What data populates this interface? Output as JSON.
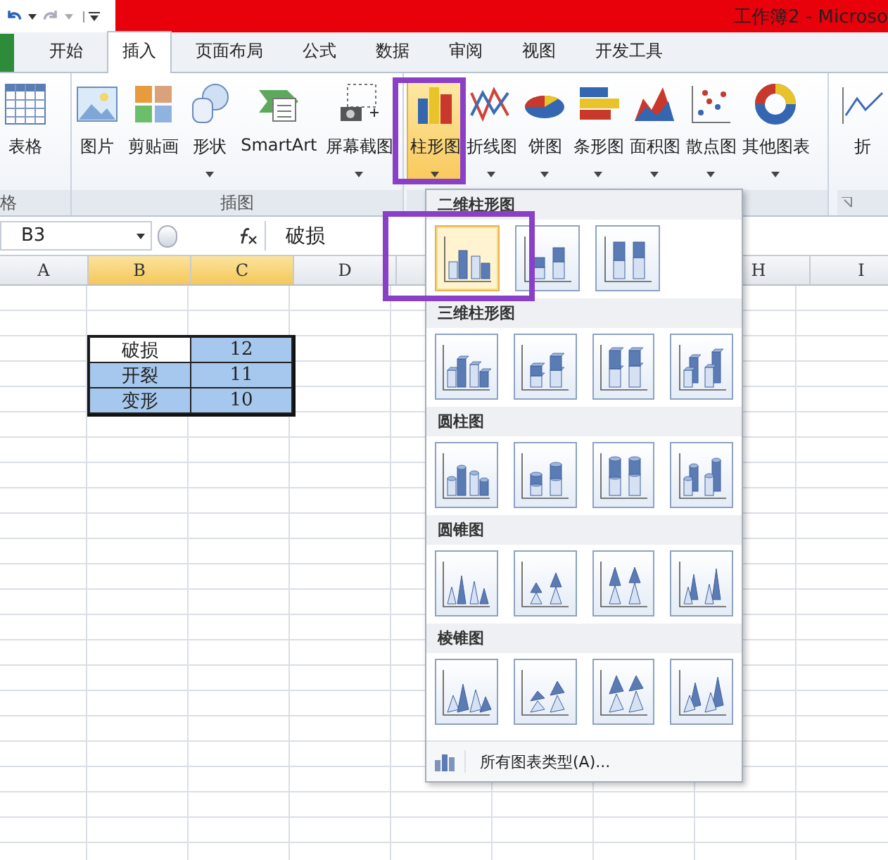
{
  "title_bar": {
    "title": "工作簿2 - Microso"
  },
  "tabs": [
    {
      "label": "开始",
      "selected": false
    },
    {
      "label": "插入",
      "selected": true
    },
    {
      "label": "页面布局",
      "selected": false
    },
    {
      "label": "公式",
      "selected": false
    },
    {
      "label": "数据",
      "selected": false
    },
    {
      "label": "审阅",
      "selected": false
    },
    {
      "label": "视图",
      "selected": false
    },
    {
      "label": "开发工具",
      "selected": false
    }
  ],
  "ribbon": {
    "groups": [
      {
        "label": "格",
        "buttons": [
          {
            "label": "表格",
            "kind": "table",
            "menu": false,
            "selected": false
          }
        ]
      },
      {
        "label": "插图",
        "buttons": [
          {
            "label": "图片",
            "kind": "picture",
            "menu": false,
            "selected": false
          },
          {
            "label": "剪贴画",
            "kind": "clipart",
            "menu": false,
            "selected": false
          },
          {
            "label": "形状",
            "kind": "shapes",
            "menu": true,
            "selected": false
          },
          {
            "label": "SmartArt",
            "kind": "smartart",
            "menu": false,
            "selected": false
          },
          {
            "label": "屏幕截图",
            "kind": "screenshot",
            "menu": true,
            "selected": false
          }
        ]
      },
      {
        "buttons": [
          {
            "label": "柱形图",
            "kind": "column",
            "menu": true,
            "selected": true
          },
          {
            "label": "折线图",
            "kind": "line",
            "menu": true,
            "selected": false
          },
          {
            "label": "饼图",
            "kind": "pie",
            "menu": true,
            "selected": false
          },
          {
            "label": "条形图",
            "kind": "bar",
            "menu": true,
            "selected": false
          },
          {
            "label": "面积图",
            "kind": "area",
            "menu": true,
            "selected": false
          },
          {
            "label": "散点图",
            "kind": "scatter",
            "menu": true,
            "selected": false
          },
          {
            "label": "其他图表",
            "kind": "donut",
            "menu": true,
            "selected": false
          }
        ]
      },
      {
        "buttons": [
          {
            "label": "折",
            "kind": "sparkline",
            "menu": false,
            "selected": false
          }
        ]
      }
    ]
  },
  "formula_bar": {
    "name_box": "B3",
    "value": "破损"
  },
  "columns": [
    {
      "label": "A",
      "selected": false
    },
    {
      "label": "B",
      "selected": true
    },
    {
      "label": "C",
      "selected": true
    },
    {
      "label": "D",
      "selected": false
    },
    {
      "label": "H",
      "selected": false
    },
    {
      "label": "I",
      "selected": false
    }
  ],
  "data_range": [
    [
      {
        "text": "破损",
        "selected": false
      },
      {
        "text": "12",
        "selected": true
      }
    ],
    [
      {
        "text": "开裂",
        "selected": true
      },
      {
        "text": "11",
        "selected": true
      }
    ],
    [
      {
        "text": "变形",
        "selected": true
      },
      {
        "text": "10",
        "selected": true
      }
    ]
  ],
  "gallery": {
    "sections": [
      {
        "title": "二维柱形图",
        "kind": "column",
        "options": [
          {
            "kind": "clustered",
            "selected": true
          },
          {
            "kind": "stacked",
            "selected": false
          },
          {
            "kind": "percent",
            "selected": false
          }
        ]
      },
      {
        "title": "三维柱形图",
        "kind": "box",
        "options": [
          {
            "kind": "clustered",
            "selected": false
          },
          {
            "kind": "stacked",
            "selected": false
          },
          {
            "kind": "percent",
            "selected": false
          },
          {
            "kind": "deep",
            "selected": false
          }
        ]
      },
      {
        "title": "圆柱图",
        "kind": "cylinder",
        "options": [
          {
            "kind": "clustered",
            "selected": false
          },
          {
            "kind": "stacked",
            "selected": false
          },
          {
            "kind": "percent",
            "selected": false
          },
          {
            "kind": "deep",
            "selected": false
          }
        ]
      },
      {
        "title": "圆锥图",
        "kind": "cone",
        "options": [
          {
            "kind": "clustered",
            "selected": false
          },
          {
            "kind": "stacked",
            "selected": false
          },
          {
            "kind": "percent",
            "selected": false
          },
          {
            "kind": "deep",
            "selected": false
          }
        ]
      },
      {
        "title": "棱锥图",
        "kind": "pyramid",
        "options": [
          {
            "kind": "clustered",
            "selected": false
          },
          {
            "kind": "stacked",
            "selected": false
          },
          {
            "kind": "percent",
            "selected": false
          },
          {
            "kind": "deep",
            "selected": false
          }
        ]
      }
    ],
    "footer": "所有图表类型(A)..."
  }
}
